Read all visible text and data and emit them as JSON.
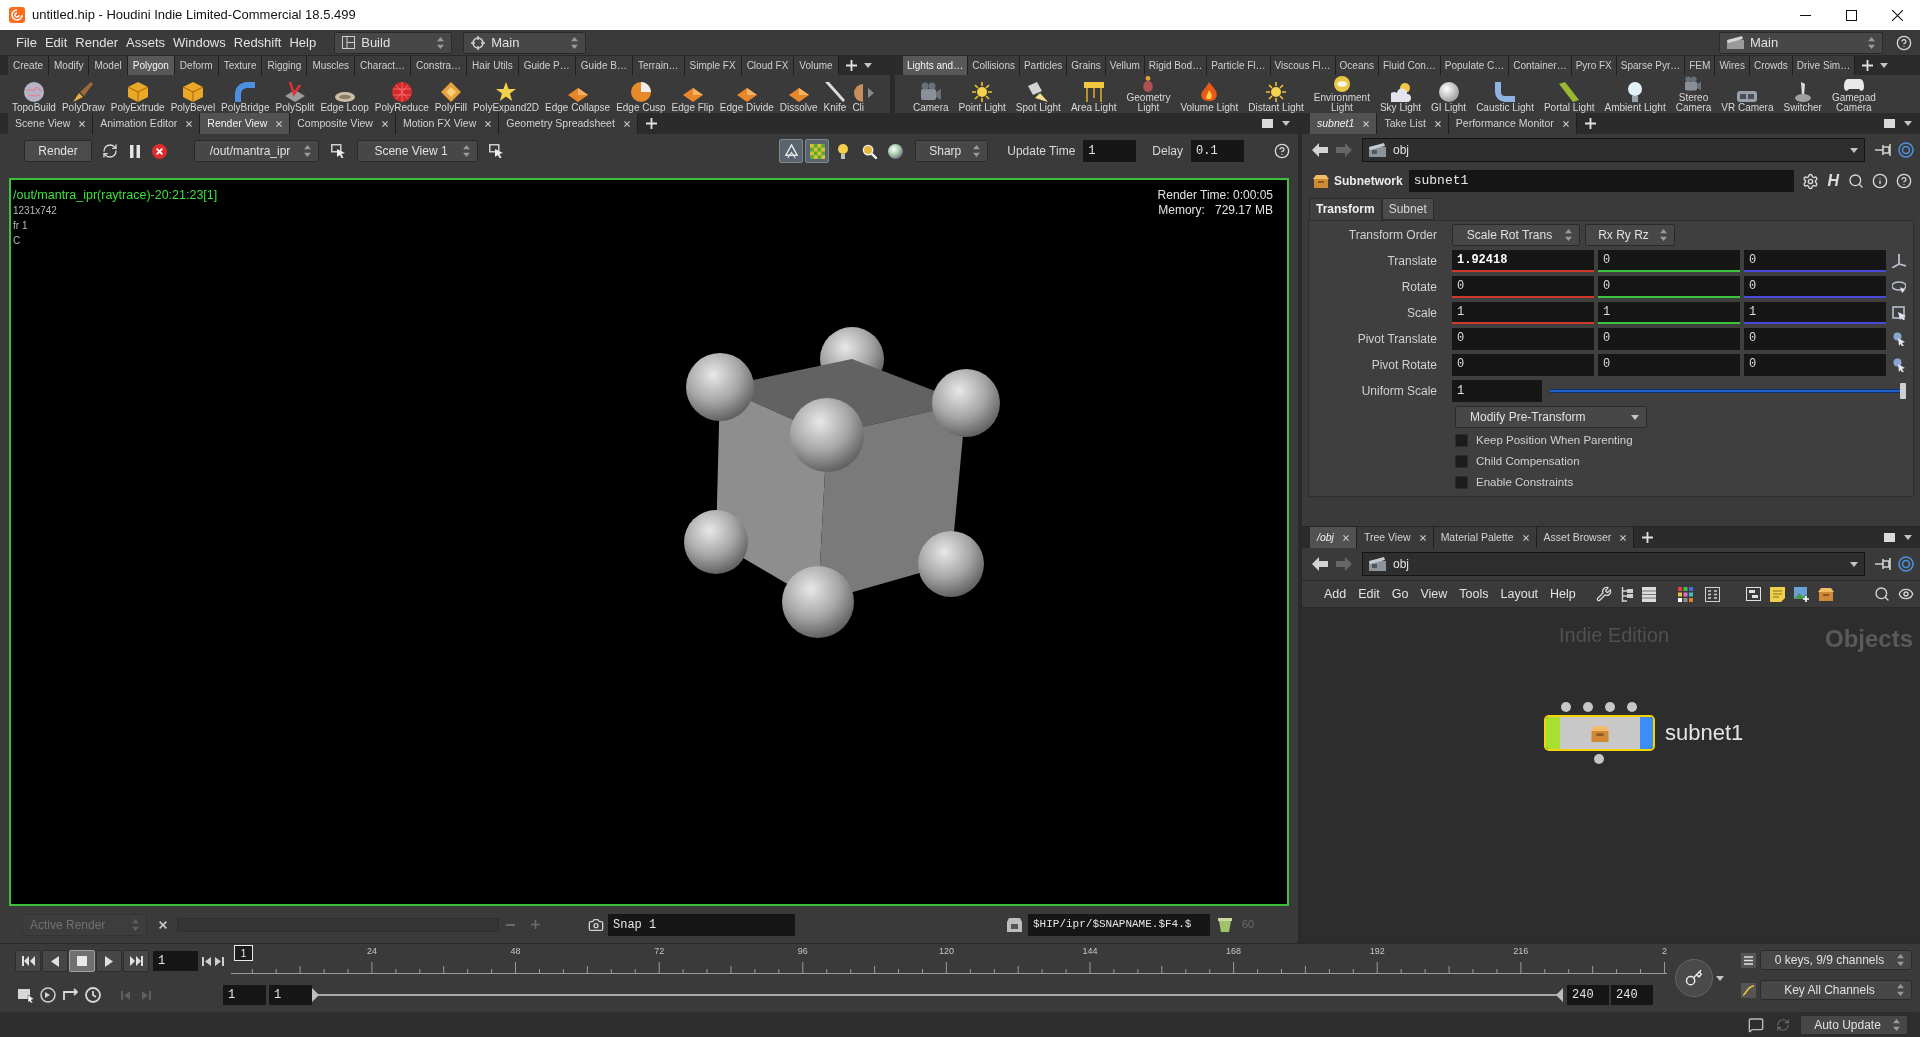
{
  "window": {
    "title": "untitled.hip - Houdini Indie Limited-Commercial 18.5.499"
  },
  "menu_bar": {
    "items": [
      "File",
      "Edit",
      "Render",
      "Assets",
      "Windows",
      "Redshift",
      "Help"
    ],
    "desktop": "Build",
    "network_context": "Main",
    "right_context": "Main"
  },
  "shelves": [
    {
      "tabs": [
        {
          "label": "Create",
          "selected": false
        },
        {
          "label": "Modify",
          "selected": false
        },
        {
          "label": "Model",
          "selected": false
        },
        {
          "label": "Polygon",
          "selected": true
        },
        {
          "label": "Deform",
          "selected": false
        },
        {
          "label": "Texture",
          "selected": false
        },
        {
          "label": "Rigging",
          "selected": false
        },
        {
          "label": "Muscles",
          "selected": false
        },
        {
          "label": "Charact…",
          "selected": false
        },
        {
          "label": "Constra…",
          "selected": false
        },
        {
          "label": "Hair Utils",
          "selected": false
        },
        {
          "label": "Guide P…",
          "selected": false
        },
        {
          "label": "Guide B…",
          "selected": false
        },
        {
          "label": "Terrain…",
          "selected": false
        },
        {
          "label": "Simple FX",
          "selected": false
        },
        {
          "label": "Cloud FX",
          "selected": false
        },
        {
          "label": "Volume",
          "selected": false
        }
      ],
      "tools": [
        "TopoBuild",
        "PolyDraw",
        "PolyExtrude",
        "PolyBevel",
        "PolyBridge",
        "PolySplit",
        "Edge Loop",
        "PolyReduce",
        "PolyFill",
        "PolyExpand2D",
        "Edge Collapse",
        "Edge Cusp",
        "Edge Flip",
        "Edge Divide",
        "Dissolve",
        "Knife",
        "Cli"
      ]
    },
    {
      "tabs": [
        {
          "label": "Lights and…",
          "selected": true
        },
        {
          "label": "Collisions",
          "selected": false
        },
        {
          "label": "Particles",
          "selected": false
        },
        {
          "label": "Grains",
          "selected": false
        },
        {
          "label": "Vellum",
          "selected": false
        },
        {
          "label": "Rigid Bod…",
          "selected": false
        },
        {
          "label": "Particle Fl…",
          "selected": false
        },
        {
          "label": "Viscous Fl…",
          "selected": false
        },
        {
          "label": "Oceans",
          "selected": false
        },
        {
          "label": "Fluid Con…",
          "selected": false
        },
        {
          "label": "Populate C…",
          "selected": false
        },
        {
          "label": "Container…",
          "selected": false
        },
        {
          "label": "Pyro FX",
          "selected": false
        },
        {
          "label": "Sparse Pyr…",
          "selected": false
        },
        {
          "label": "FEM",
          "selected": false
        },
        {
          "label": "Wires",
          "selected": false
        },
        {
          "label": "Crowds",
          "selected": false
        },
        {
          "label": "Drive Sim…",
          "selected": false
        }
      ],
      "tools": [
        "Camera",
        "Point Light",
        "Spot Light",
        "Area Light",
        "Geometry\nLight",
        "Volume Light",
        "Distant Light",
        "Environment\nLight",
        "Sky Light",
        "GI Light",
        "Caustic Light",
        "Portal Light",
        "Ambient Light",
        "Stereo\nCamera",
        "VR Camera",
        "Switcher",
        "Gamepad\nCamera"
      ]
    }
  ],
  "viewer": {
    "tabs": [
      {
        "label": "Scene View",
        "selected": false
      },
      {
        "label": "Animation Editor",
        "selected": false
      },
      {
        "label": "Render View",
        "selected": true
      },
      {
        "label": "Composite View",
        "selected": false
      },
      {
        "label": "Motion FX View",
        "selected": false
      },
      {
        "label": "Geometry Spreadsheet",
        "selected": false
      }
    ],
    "toolbar": {
      "render_button": "Render",
      "driver": "/out/mantra_ipr",
      "camera": "Scene View 1",
      "toggles": [
        {
          "on": true
        },
        {
          "on": true
        },
        {
          "on": false
        },
        {
          "on": false
        },
        {
          "on": false
        }
      ],
      "preview": "Sharp",
      "update_time_label": "Update Time",
      "update_time": "1",
      "delay_label": "Delay",
      "delay": "0.1"
    },
    "overlay": {
      "source": "/out/mantra_ipr(raytrace)-20:21:23[1]",
      "resolution": "1231x742",
      "frame": "fr 1",
      "channel": "C",
      "render_time": "Render Time: 0:00:05",
      "memory_label": "Memory:",
      "memory": "729.17 MB"
    },
    "snapshot_bar": {
      "active_render": {
        "label": "Active Render",
        "disabled": true
      },
      "slider": {
        "disabled": true
      },
      "snapshot": "Snap 1",
      "path": "$HIP/ipr/$SNAPNAME.$F4.$",
      "count": {
        "label": "60",
        "disabled": true
      }
    }
  },
  "parameters": {
    "tabs": [
      {
        "label": "subnet1",
        "kind": "network",
        "selected": true
      },
      {
        "label": "Take List",
        "kind": "panel",
        "selected": false
      },
      {
        "label": "Performance Monitor",
        "kind": "panel",
        "selected": false
      }
    ],
    "path": "obj",
    "node_type": "Subnetwork",
    "node_name": "subnet1",
    "operator_glyph": "H",
    "page_tabs": [
      {
        "label": "Transform",
        "selected": true
      },
      {
        "label": "Subnet",
        "selected": false
      }
    ],
    "params": [
      {
        "kind": "menus",
        "label": "Transform Order",
        "values": [
          "Scale Rot Trans",
          "Rx Ry Rz"
        ]
      },
      {
        "kind": "vector",
        "label": "Translate",
        "axis_colored": true,
        "values": [
          {
            "value": "1.92418",
            "modified": true
          },
          {
            "value": "0",
            "modified": false
          },
          {
            "value": "0",
            "modified": false
          }
        ]
      },
      {
        "kind": "vector",
        "label": "Rotate",
        "axis_colored": true,
        "values": [
          {
            "value": "0",
            "modified": false
          },
          {
            "value": "0",
            "modified": false
          },
          {
            "value": "0",
            "modified": false
          }
        ]
      },
      {
        "kind": "vector",
        "label": "Scale",
        "axis_colored": true,
        "values": [
          {
            "value": "1",
            "modified": false
          },
          {
            "value": "1",
            "modified": false
          },
          {
            "value": "1",
            "modified": false
          }
        ]
      },
      {
        "kind": "vector",
        "label": "Pivot Translate",
        "axis_colored": false,
        "values": [
          {
            "value": "0",
            "modified": false
          },
          {
            "value": "0",
            "modified": false
          },
          {
            "value": "0",
            "modified": false
          }
        ]
      },
      {
        "kind": "vector",
        "label": "Pivot Rotate",
        "axis_colored": false,
        "values": [
          {
            "value": "0",
            "modified": false
          },
          {
            "value": "0",
            "modified": false
          },
          {
            "value": "0",
            "modified": false
          }
        ]
      },
      {
        "kind": "slider",
        "label": "Uniform Scale",
        "value": "1",
        "level": 1
      },
      {
        "kind": "menu",
        "value": "Modify Pre-Transform"
      },
      {
        "kind": "toggle",
        "label": "Keep Position When Parenting",
        "checked": false
      },
      {
        "kind": "toggle",
        "label": "Child Compensation",
        "checked": false
      },
      {
        "kind": "toggle",
        "label": "Enable Constraints",
        "checked": false
      }
    ]
  },
  "network": {
    "tabs": [
      {
        "label": "/obj",
        "kind": "network",
        "selected": true
      },
      {
        "label": "Tree View",
        "kind": "panel",
        "selected": false
      },
      {
        "label": "Material Palette",
        "kind": "panel",
        "selected": false
      },
      {
        "label": "Asset Browser",
        "kind": "panel",
        "selected": false
      }
    ],
    "path": "obj",
    "menu": [
      "Add",
      "Edit",
      "Go",
      "View",
      "Tools",
      "Layout",
      "Help"
    ],
    "edition": "Indie Edition",
    "context_label": "Objects",
    "nodes": [
      {
        "name": "subnet1",
        "selected": true
      }
    ]
  },
  "timeline": {
    "playback": [
      {
        "selected": false
      },
      {
        "selected": false
      },
      {
        "selected": true
      },
      {
        "selected": false
      },
      {
        "selected": false
      }
    ],
    "frame": "1",
    "current_frame": "1",
    "ruler_labels": [
      "24",
      "48",
      "72",
      "96",
      "120",
      "144",
      "168",
      "192",
      "216",
      "2"
    ],
    "start": "1",
    "playback_start": "1",
    "range": {
      "level": 1
    },
    "playback_end": "240",
    "end": "240",
    "keys_info": "0 keys, 9/9 channels",
    "key_mode": "Key All Channels"
  },
  "status_bar": {
    "update_mode": "Auto Update"
  }
}
